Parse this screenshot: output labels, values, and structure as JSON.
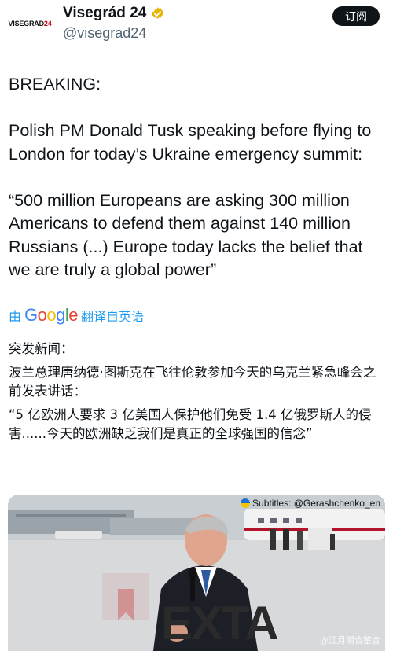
{
  "account": {
    "avatar_text_prefix": "VISEGRAD",
    "avatar_text_num": "24",
    "name": "Visegrád 24",
    "handle": "@visegrad24",
    "follow_label": "订阅"
  },
  "tweet": {
    "lines": [
      "BREAKING:",
      "Polish PM Donald Tusk speaking before flying to London for today’s Ukraine emergency summit:",
      "“500 million Europeans are asking 300 million Americans to defend them against 140 million Russians (...) Europe today lacks the belief that we are truly a global power”"
    ]
  },
  "translate": {
    "prefix": "由",
    "google": [
      "G",
      "o",
      "o",
      "g",
      "l",
      "e"
    ],
    "suffix": "翻译自英语"
  },
  "translation": {
    "lines": [
      "突发新闻：",
      "波兰总理唐纳德·图斯克在飞往伦敦参加今天的乌克兰紧急峰会之前发表讲话：",
      "“5 亿欧洲人要求 3 亿美国人保护他们免受 1.4 亿俄罗斯人的侵害......今天的欧洲缺乏我们是真正的全球强国的信念”"
    ]
  },
  "media": {
    "subtitle_credit": "Subtitles: @Gerashchenko_en",
    "overlay_text": "EXTA",
    "watermark": "@江月明合鉴合",
    "colors": {
      "sky": "#c9ced3",
      "tarmac": "#d7d9db",
      "suit": "#1c1f26",
      "plane": "#f2f2f2",
      "plane_stripe": "#b3122b"
    }
  }
}
